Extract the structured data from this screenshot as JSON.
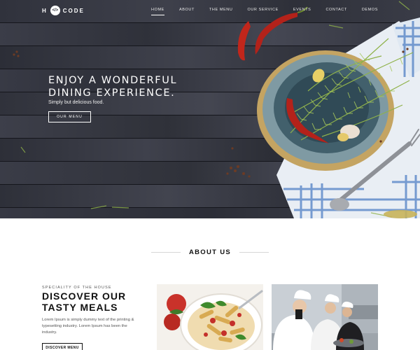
{
  "logo": {
    "left": "H",
    "badge": "</>",
    "right": "CODE"
  },
  "nav": {
    "items": [
      "HOME",
      "ABOUT",
      "THE MENU",
      "OUR SERVICE",
      "EVENTS",
      "CONTACT",
      "DEMOS"
    ],
    "active": "HOME"
  },
  "hero": {
    "title_line1": "ENJOY A WONDERFUL",
    "title_line2": "DINING EXPERIENCE.",
    "subtitle": "Simply but delicious food.",
    "button": "OUR MENU"
  },
  "about": {
    "title": "ABOUT US",
    "kicker": "SPECIALITY OF THE HOUSE",
    "heading_line1": "DISCOVER OUR",
    "heading_line2": "TASTY MEALS",
    "body": "Lorem Ipsum is simply dummy text of the printing & typesetting industry. Lorem Ipsum has been the industry.",
    "button": "DISCOVER MENU"
  },
  "colors": {
    "wood_dark": "#2b2d36",
    "wood_light": "#4a4c58",
    "accent_red": "#b3221a",
    "herb_green": "#7c9c3c"
  },
  "icons": {
    "logo_badge": "code-brackets-icon"
  }
}
